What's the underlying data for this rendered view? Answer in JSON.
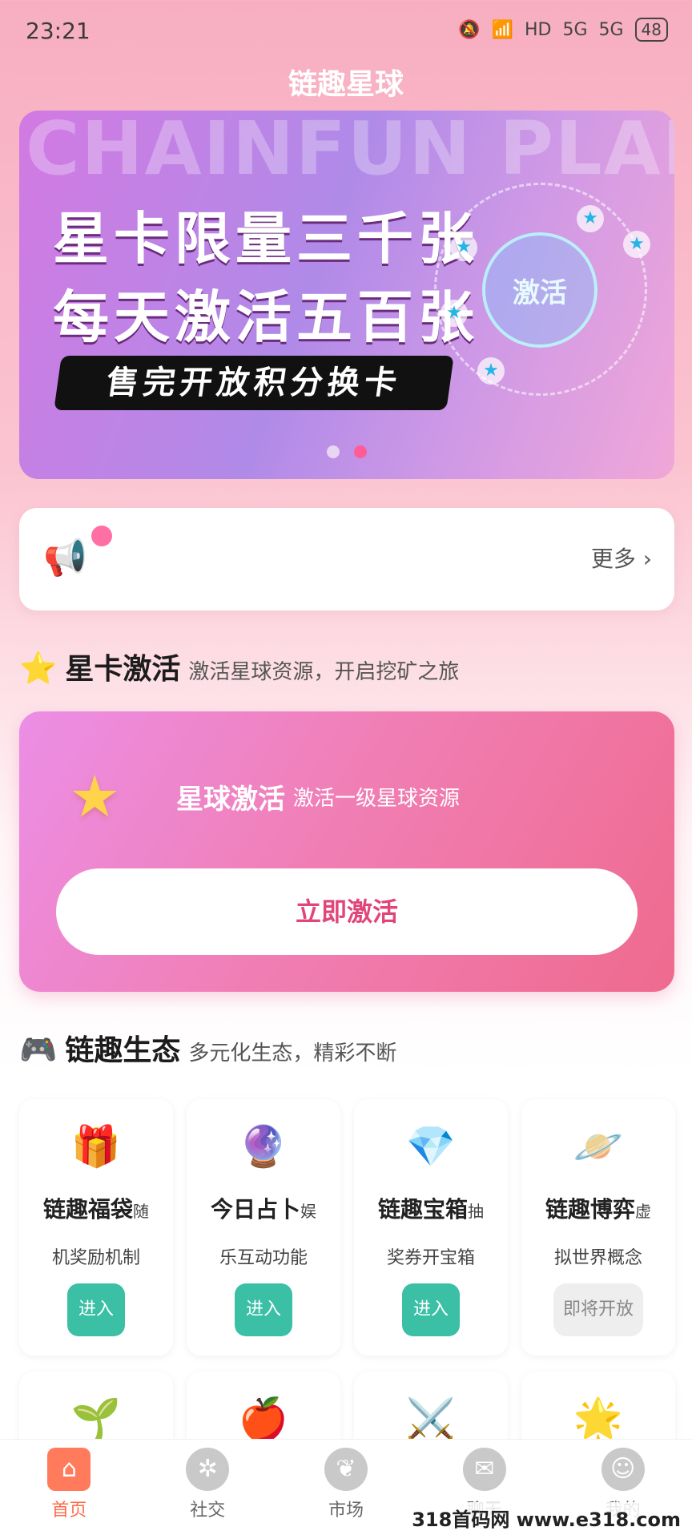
{
  "status_bar": {
    "time": "23:21",
    "battery": "48",
    "signal_1": "5G",
    "signal_2": "5G",
    "hd_1": "HD",
    "hd_2": "HD"
  },
  "app_title": "链趣星球",
  "banner": {
    "watermark": "CHAINFUN PLANT",
    "line1": "星卡限量三千张",
    "line2": "每天激活五百张",
    "pill": "售完开放积分换卡",
    "badge": "激活"
  },
  "notice": {
    "more": "更多 ›"
  },
  "section_activation": {
    "emoji": "⭐",
    "title": "星卡激活",
    "subtitle": "激活星球资源，开启挖矿之旅"
  },
  "activation_card": {
    "title": "星球激活",
    "subtitle": "激活一级星球资源",
    "button": "立即激活"
  },
  "section_ecosystem": {
    "emoji": "🎮",
    "title": "链趣生态",
    "subtitle": "多元化生态，精彩不断"
  },
  "cards": [
    {
      "icon": "🎁",
      "name": "链趣福袋",
      "tag": "随",
      "desc": "机奖励机制",
      "action": "进入"
    },
    {
      "icon": "🔮",
      "name": "今日占卜",
      "tag": "娱",
      "desc": "乐互动功能",
      "action": "进入"
    },
    {
      "icon": "💎",
      "name": "链趣宝箱",
      "tag": "抽",
      "desc": "奖券开宝箱",
      "action": "进入"
    },
    {
      "icon": "🪐",
      "name": "链趣博弈",
      "tag": "虚",
      "desc": "拟世界概念",
      "action": "即将开放"
    },
    {
      "icon": "🌱"
    },
    {
      "icon": "🍎"
    },
    {
      "icon": "⚔️"
    },
    {
      "icon": "🌟"
    }
  ],
  "tabbar": [
    {
      "label": "首页",
      "icon": "home-icon"
    },
    {
      "label": "社交",
      "icon": "social-icon"
    },
    {
      "label": "市场",
      "icon": "market-icon"
    },
    {
      "label": "聊天",
      "icon": "chat-icon"
    },
    {
      "label": "我的",
      "icon": "profile-icon"
    }
  ],
  "watermark": "318首码网 www.e318.com"
}
